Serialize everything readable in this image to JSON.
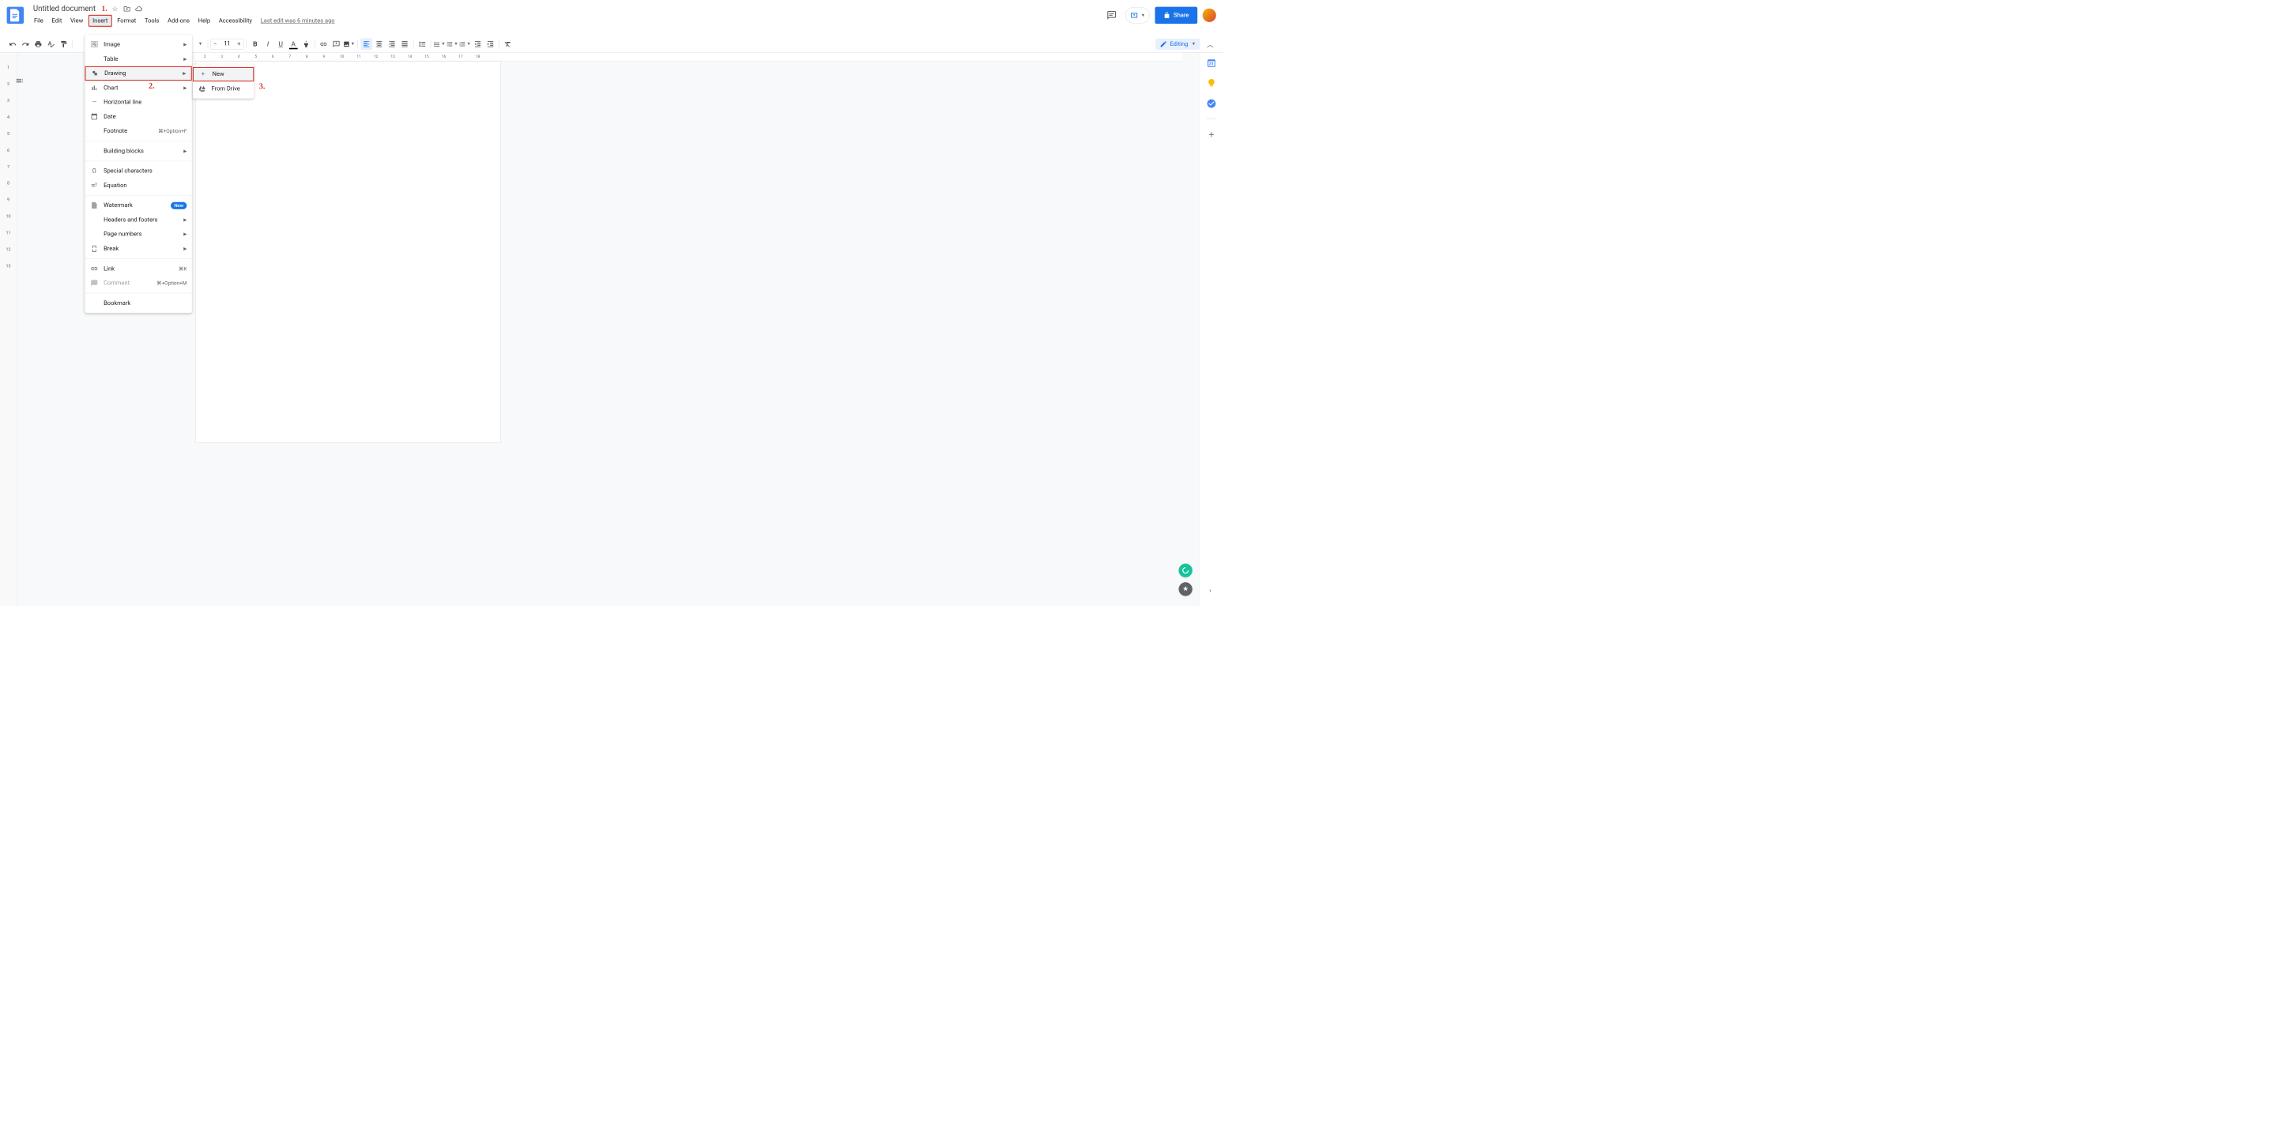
{
  "header": {
    "title": "Untitled document",
    "last_edit": "Last edit was 6 minutes ago",
    "share_label": "Share"
  },
  "annotations": {
    "a1": "1.",
    "a2": "2.",
    "a3": "3."
  },
  "menubar": {
    "file": "File",
    "edit": "Edit",
    "view": "View",
    "insert": "Insert",
    "format": "Format",
    "tools": "Tools",
    "addons": "Add-ons",
    "help": "Help",
    "accessibility": "Accessibility"
  },
  "toolbar": {
    "font_size": "11",
    "editing_label": "Editing"
  },
  "insert_menu": {
    "image": "Image",
    "table": "Table",
    "drawing": "Drawing",
    "chart": "Chart",
    "horizontal_line": "Horizontal line",
    "date": "Date",
    "footnote": "Footnote",
    "footnote_shortcut": "⌘+Option+F",
    "building_blocks": "Building blocks",
    "special_characters": "Special characters",
    "equation": "Equation",
    "watermark": "Watermark",
    "new_badge": "New",
    "headers_footers": "Headers and footers",
    "page_numbers": "Page numbers",
    "break": "Break",
    "link": "Link",
    "link_shortcut": "⌘K",
    "comment": "Comment",
    "comment_shortcut": "⌘+Option+M",
    "bookmark": "Bookmark"
  },
  "drawing_submenu": {
    "new": "New",
    "from_drive": "From Drive"
  },
  "ruler_top": [
    "2",
    "3",
    "4",
    "5",
    "6",
    "7",
    "8",
    "9",
    "10",
    "11",
    "12",
    "13",
    "14",
    "15",
    "16",
    "17",
    "18"
  ],
  "ruler_left": [
    "1",
    "2",
    "3",
    "4",
    "5",
    "6",
    "7",
    "8",
    "9",
    "10",
    "11",
    "12",
    "13"
  ]
}
